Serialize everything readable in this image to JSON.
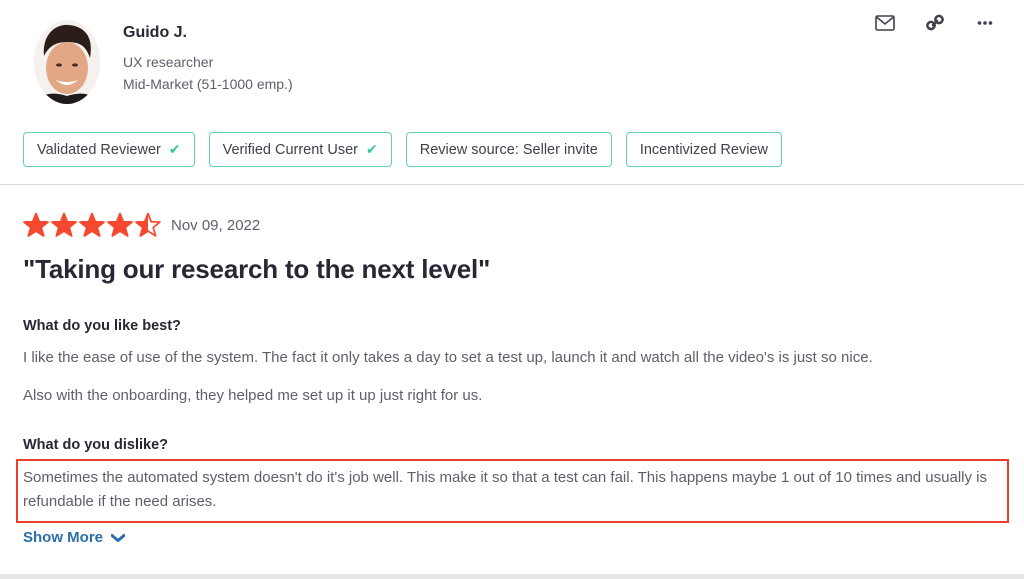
{
  "reviewer": {
    "name": "Guido J.",
    "role": "UX researcher",
    "segment": "Mid-Market (51-1000 emp.)"
  },
  "actions": [
    {
      "icon": "mail-icon",
      "label": "Email"
    },
    {
      "icon": "link-icon",
      "label": "Copy link"
    },
    {
      "icon": "more-icon",
      "label": "More"
    }
  ],
  "badges": [
    {
      "label": "Validated Reviewer",
      "checked": true
    },
    {
      "label": "Verified Current User",
      "checked": true
    },
    {
      "label": "Review source: Seller invite",
      "checked": false
    },
    {
      "label": "Incentivized Review",
      "checked": false
    }
  ],
  "review": {
    "rating": 4.5,
    "rating_max": 5,
    "date": "Nov 09, 2022",
    "title": "\"Taking our research to the next level\"",
    "like_question": "What do you like best?",
    "like_paragraph_1": "I like the ease of use of the system. The fact it only takes a day to set a test up, launch it and watch all the video's is just so nice.",
    "like_paragraph_2": "Also with the onboarding, they helped me set up it up just right for us.",
    "dislike_question": "What do you dislike?",
    "dislike_text": "Sometimes the automated system doesn't do it's job well. This make it so that a test can fail. This happens maybe 1 out of 10 times and usually is refundable if the need arises.",
    "show_more_label": "Show More"
  },
  "colors": {
    "star": "#f5492f",
    "badge_border": "#5fd3b3",
    "check": "#35c49c",
    "highlight": "#e8402a",
    "link": "#2a6fa8"
  }
}
